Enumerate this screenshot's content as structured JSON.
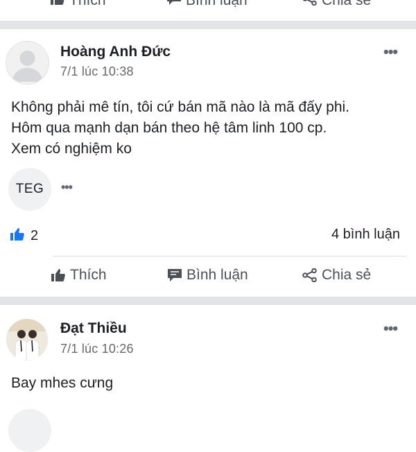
{
  "top_actions": {
    "like_label": "Thích",
    "comment_label": "Bình luận",
    "share_label": "Chia sẻ"
  },
  "post1": {
    "author": "Hoàng Anh Đức",
    "time": "7/1 lúc 10:38",
    "more_label": "•••",
    "body_lines": [
      "Không phải mê tín, tôi cứ bán mã nào là mã đấy phi.",
      "Hôm qua mạnh dạn bán theo hệ tâm linh 100 cp.",
      "Xem có nghiệm ko"
    ],
    "tag": "TEG",
    "tag_more": "•••",
    "like_count": "2",
    "comment_count": "4 bình luận",
    "actions": {
      "like_label": "Thích",
      "comment_label": "Bình luận",
      "share_label": "Chia sẻ"
    }
  },
  "post2": {
    "author": "Đạt Thiều",
    "time": "7/1 lúc 10:26",
    "more_label": "•••",
    "body": "Bay mhes cưng"
  },
  "colors": {
    "like_blue": "#1877f2",
    "divider": "#e3e4e8",
    "secondary_text": "#65676b"
  },
  "icons": [
    "like-icon",
    "comment-icon",
    "share-icon",
    "more-icon",
    "avatar-placeholder-icon"
  ]
}
